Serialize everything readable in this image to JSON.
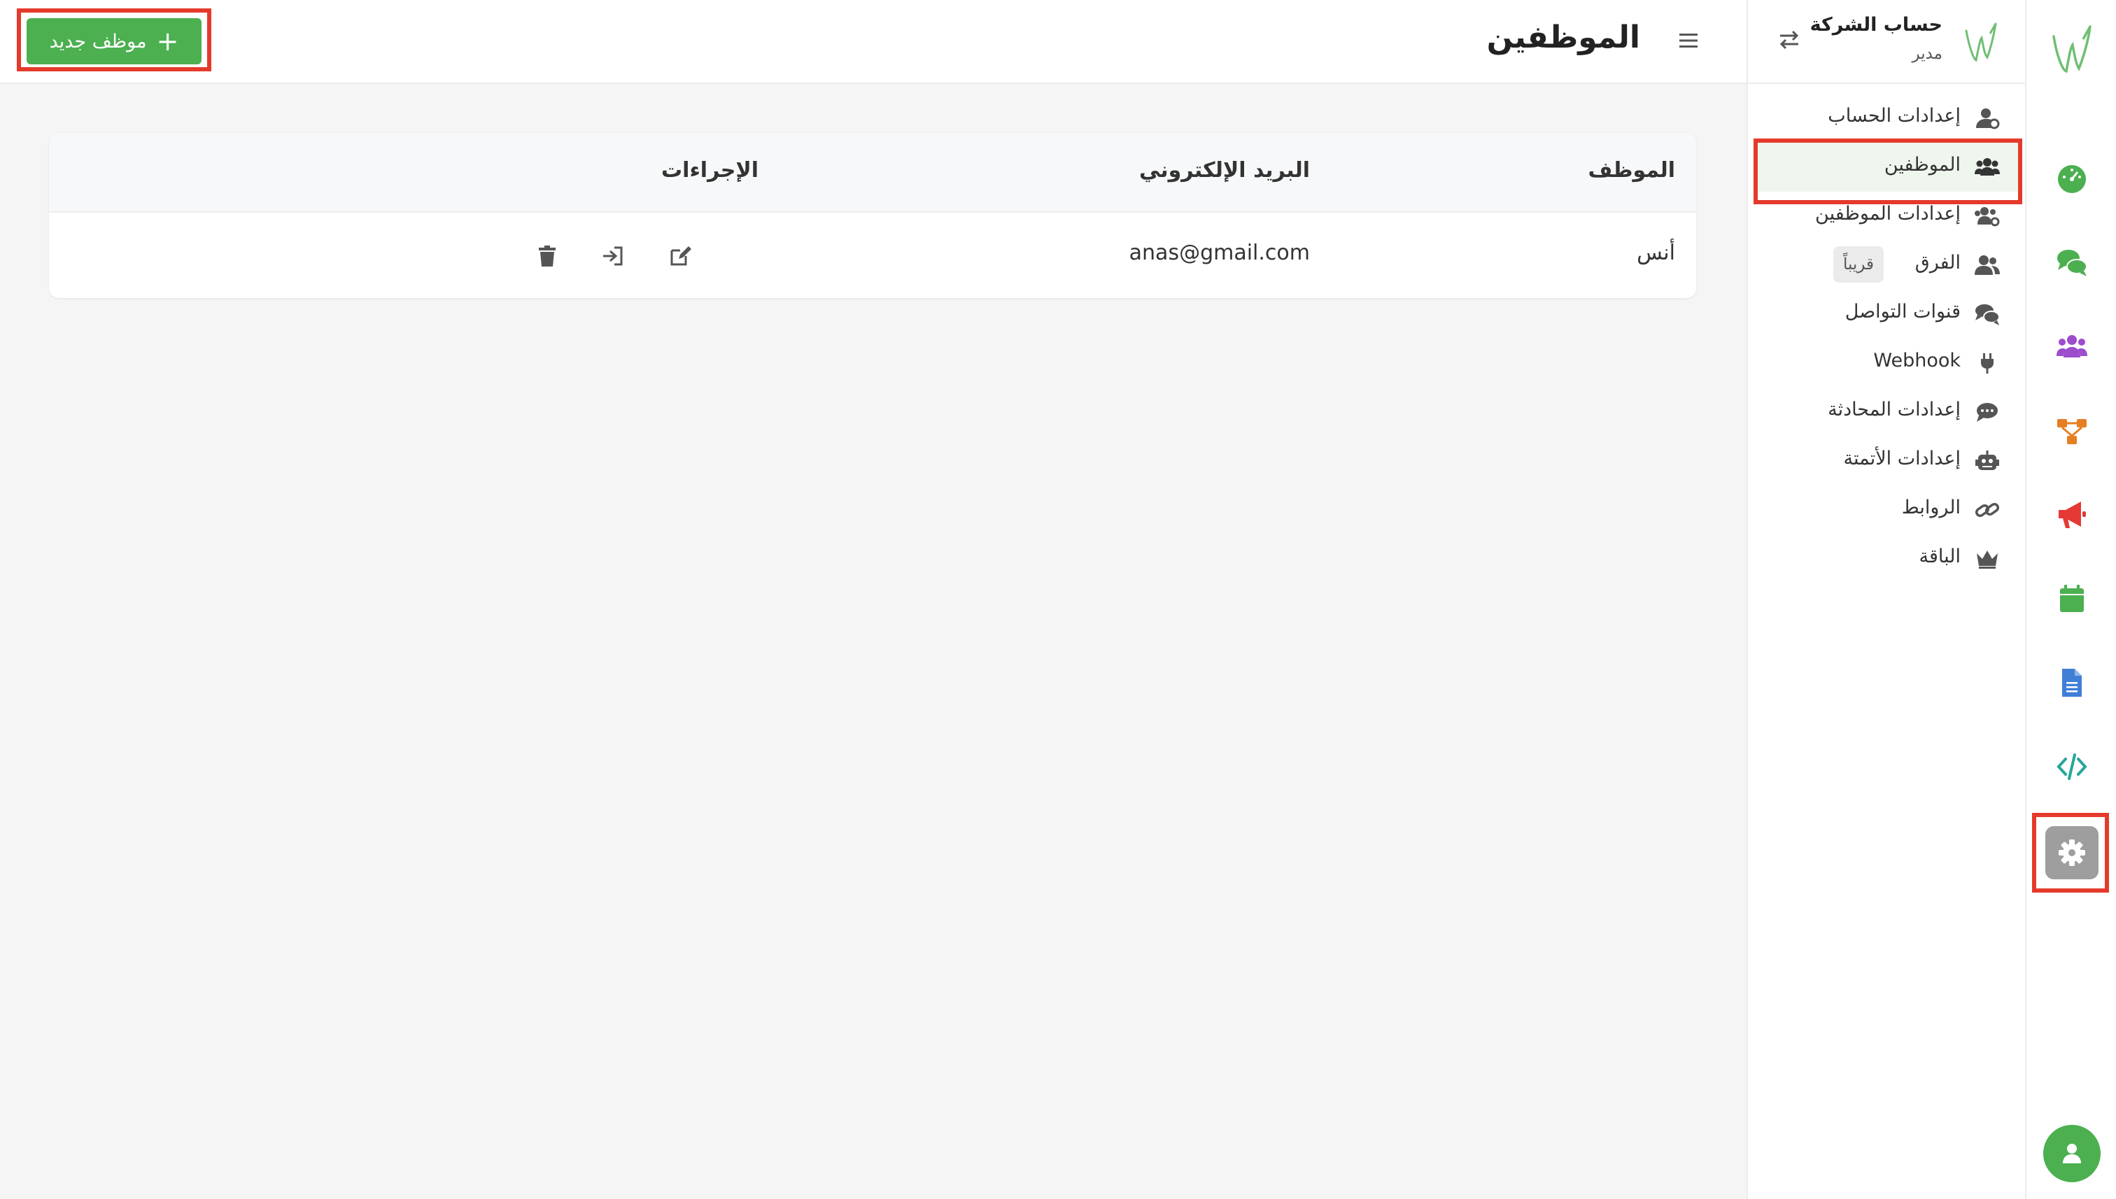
{
  "account": {
    "name": "حساب الشركة",
    "role": "مدير"
  },
  "header": {
    "title": "الموظفين",
    "new_button_label": "موظف جديد"
  },
  "sidebar": {
    "items": [
      {
        "label": "إعدادات الحساب",
        "icon": "user-cog-icon"
      },
      {
        "label": "الموظفين",
        "icon": "users-icon",
        "active": true
      },
      {
        "label": "إعدادات الموظفين",
        "icon": "users-cog-icon"
      },
      {
        "label": "الفرق",
        "icon": "team-icon",
        "badge": "قريباً"
      },
      {
        "label": "قنوات التواصل",
        "icon": "comments-icon"
      },
      {
        "label": "Webhook",
        "icon": "plug-icon"
      },
      {
        "label": "إعدادات المحادثة",
        "icon": "comment-dots-icon"
      },
      {
        "label": "إعدادات الأتمتة",
        "icon": "robot-icon"
      },
      {
        "label": "الروابط",
        "icon": "link-icon"
      },
      {
        "label": "الباقة",
        "icon": "crown-icon"
      }
    ]
  },
  "rail": {
    "items": [
      {
        "icon": "dashboard-gauge-icon",
        "color": "#4caf50"
      },
      {
        "icon": "chat-bubbles-icon",
        "color": "#4caf50"
      },
      {
        "icon": "contacts-group-icon",
        "color": "#9c4dcc"
      },
      {
        "icon": "flow-diagram-icon",
        "color": "#e67e22"
      },
      {
        "icon": "megaphone-icon",
        "color": "#e53935"
      },
      {
        "icon": "calendar-icon",
        "color": "#4caf50"
      },
      {
        "icon": "document-icon",
        "color": "#3f7fd6"
      },
      {
        "icon": "code-icon",
        "color": "#26a69a"
      },
      {
        "icon": "settings-gear-icon",
        "color": "#ffffff",
        "active": true
      }
    ]
  },
  "table": {
    "headers": {
      "employee": "الموظف",
      "email": "البريد الإلكتروني",
      "actions": "الإجراءات"
    },
    "rows": [
      {
        "employee": "أنس",
        "email": "anas@gmail.com"
      }
    ]
  },
  "colors": {
    "accent": "#4caf50",
    "highlight": "#e53a2b"
  }
}
